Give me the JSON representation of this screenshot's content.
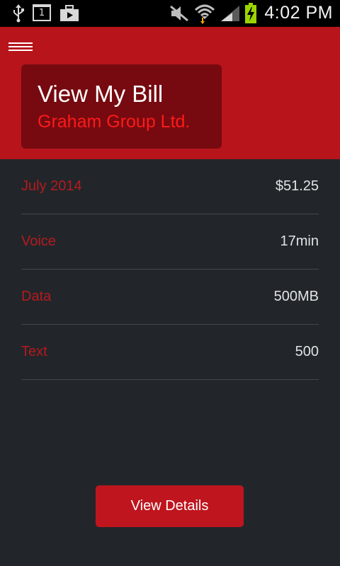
{
  "status_bar": {
    "time": "4:02 PM",
    "calendar_day": "1",
    "icons": [
      "usb-icon",
      "calendar-icon",
      "briefcase-icon",
      "mute-icon",
      "wifi-icon",
      "signal-icon",
      "battery-charging-icon"
    ]
  },
  "header": {
    "title": "View My Bill",
    "subtitle": "Graham Group Ltd."
  },
  "bill": {
    "rows": [
      {
        "label": "July 2014",
        "value": "$51.25"
      },
      {
        "label": "Voice",
        "value": "17min"
      },
      {
        "label": "Data",
        "value": "500MB"
      },
      {
        "label": "Text",
        "value": "500"
      }
    ]
  },
  "actions": {
    "view_details_label": "View Details"
  },
  "colors": {
    "brand_red": "#b8141c",
    "card_red": "#760a10",
    "subtitle_red": "#ff1a1a",
    "background": "#22262a"
  }
}
